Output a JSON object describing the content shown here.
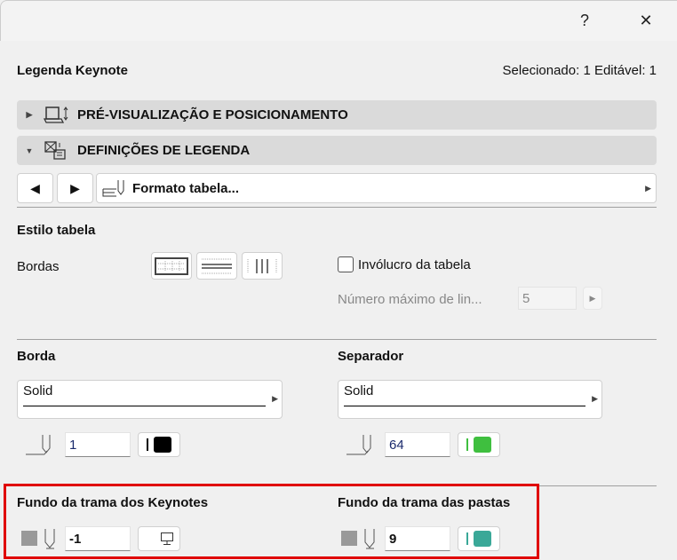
{
  "titlebar": {
    "help": "?",
    "close": "✕"
  },
  "header": {
    "title": "Legenda Keynote",
    "status": "Selecionado: 1 Editável: 1"
  },
  "sections": [
    {
      "label": "PRÉ-VISUALIZAÇÃO E POSICIONAMENTO",
      "expanded": false
    },
    {
      "label": "DEFINIÇÕES DE LEGENDA",
      "expanded": true
    }
  ],
  "nav": {
    "prev": "◀",
    "next": "▶",
    "format_label": "Formato tabela..."
  },
  "table_style": {
    "heading": "Estilo tabela",
    "borders_label": "Bordas",
    "wrap_label": "Invólucro da tabela",
    "wrap_checked": false,
    "max_lines_label": "Número máximo de lin...",
    "max_lines_value": "5"
  },
  "border": {
    "heading": "Borda",
    "line_type": "Solid",
    "pen": "1",
    "color": "#000000"
  },
  "separator": {
    "heading": "Separador",
    "line_type": "Solid",
    "pen": "64",
    "color": "#3fbf3f"
  },
  "keynote_bg": {
    "heading": "Fundo da trama dos Keynotes",
    "pen": "-1"
  },
  "folder_bg": {
    "heading": "Fundo da trama das pastas",
    "pen": "9",
    "color": "#3aa898"
  },
  "colors": {
    "highlight": "#e00000",
    "section_bg": "#dadada"
  }
}
